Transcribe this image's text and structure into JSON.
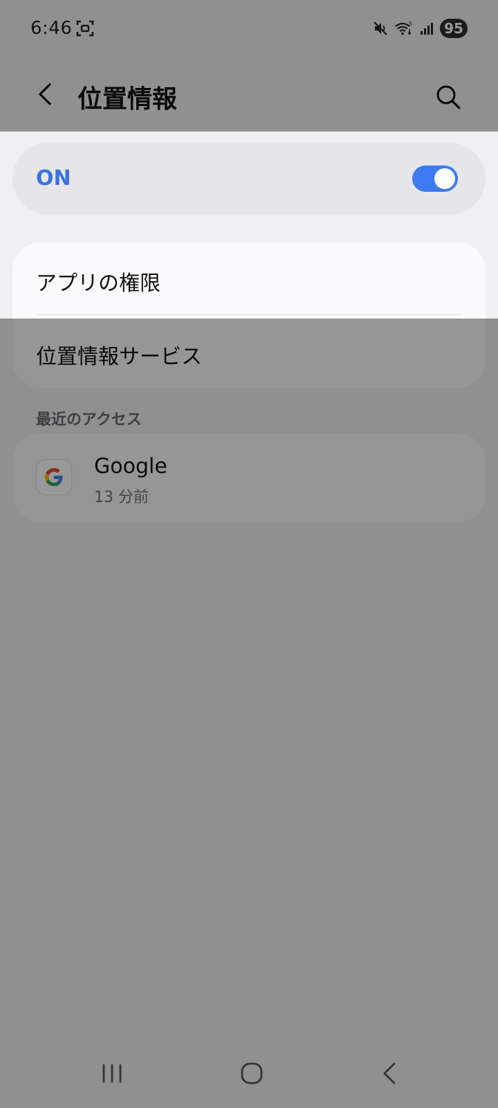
{
  "status_bar": {
    "time": "6:46",
    "battery": "95",
    "icons": [
      "screen-record-icon",
      "mute-icon",
      "wifi-5ghz-icon",
      "signal-icon",
      "battery-icon"
    ]
  },
  "header": {
    "title": "位置情報",
    "back_icon": "chevron-left-icon",
    "search_icon": "search-icon"
  },
  "master_switch": {
    "label": "ON",
    "state": true,
    "accent_color": "#3b72e0"
  },
  "menu": {
    "items": [
      {
        "label": "アプリの権限"
      },
      {
        "label": "位置情報サービス"
      }
    ]
  },
  "recent_access": {
    "title": "最近のアクセス",
    "apps": [
      {
        "name": "Google",
        "time": "13 分前",
        "icon": "google-icon"
      }
    ]
  },
  "nav_bar": {
    "buttons": [
      "recents-icon",
      "home-icon",
      "back-icon"
    ]
  }
}
